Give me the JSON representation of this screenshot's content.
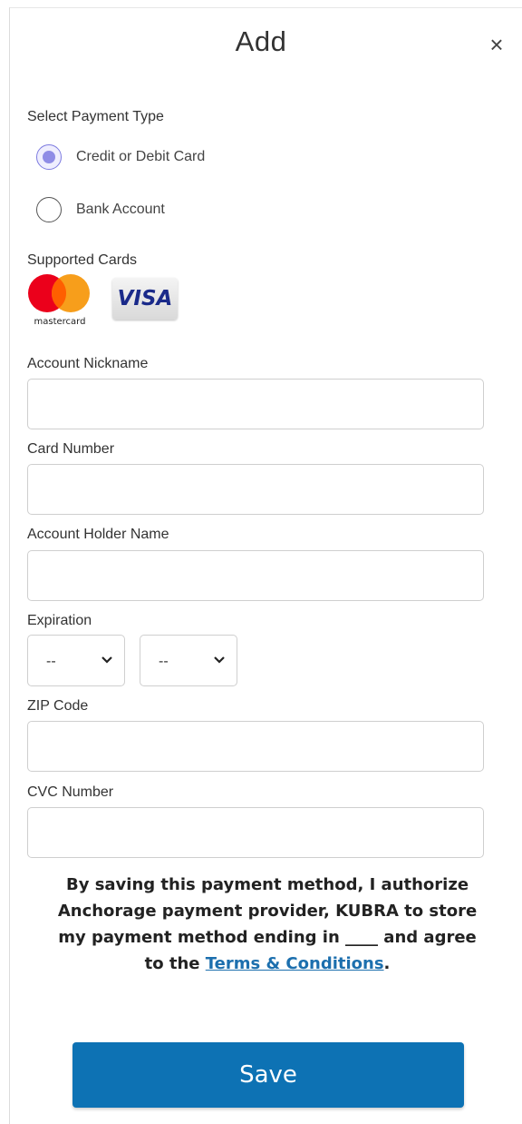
{
  "dialog": {
    "title": "Add",
    "close_label": "×"
  },
  "payment_type": {
    "label": "Select Payment Type",
    "options": [
      {
        "label": "Credit or Debit Card",
        "selected": true
      },
      {
        "label": "Bank Account",
        "selected": false
      }
    ]
  },
  "supported_cards": {
    "label": "Supported Cards",
    "cards": [
      {
        "name": "mastercard",
        "wordmark": "mastercard",
        "colors": [
          "#eb001b",
          "#f79e1b",
          "#ff5f00"
        ]
      },
      {
        "name": "visa",
        "wordmark": "VISA",
        "color": "#1a1f71"
      }
    ]
  },
  "fields": {
    "nickname": {
      "label": "Account Nickname",
      "value": ""
    },
    "card_number": {
      "label": "Card Number",
      "value": ""
    },
    "holder_name": {
      "label": "Account Holder Name",
      "value": ""
    },
    "expiration": {
      "label": "Expiration",
      "month": "--",
      "year": "--"
    },
    "zip": {
      "label": "ZIP Code",
      "value": ""
    },
    "cvc": {
      "label": "CVC Number",
      "value": ""
    }
  },
  "consent": {
    "text": "By saving this payment method, I authorize Anchorage payment provider, KUBRA to store my payment method ending in ____ and agree to the ",
    "link": "Terms & Conditions",
    "end": "."
  },
  "actions": {
    "save_label": "Save"
  },
  "colors": {
    "primary": "#0d72b4",
    "link": "#1c6fae",
    "radio_selected": "#8f8ce6"
  }
}
